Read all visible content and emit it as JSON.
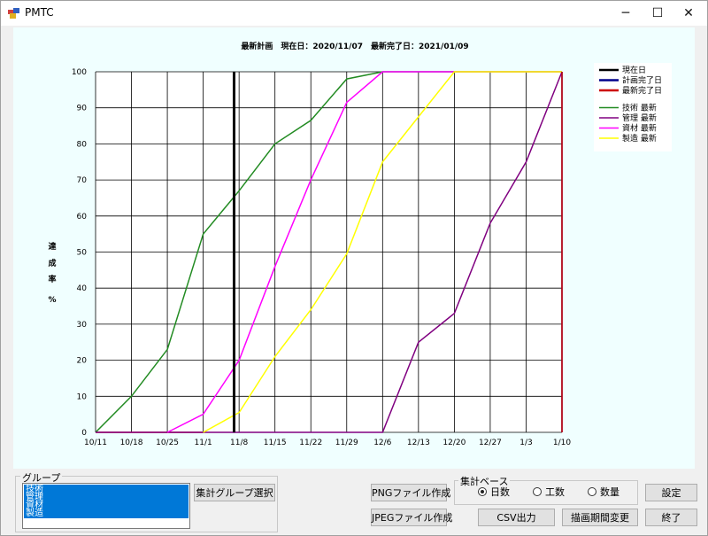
{
  "window": {
    "title": "PMTC",
    "controls": [
      "─",
      "☐",
      "✕"
    ]
  },
  "chart_data": {
    "type": "line",
    "title": "最新計画　現在日：2020/11/07　最新完了日：2021/01/09",
    "ylabel": "達成率 %",
    "xlabel": "",
    "ylim": [
      0,
      100
    ],
    "yticks": [
      0,
      10,
      20,
      30,
      40,
      50,
      60,
      70,
      80,
      90,
      100
    ],
    "categories": [
      "10/11",
      "10/18",
      "10/25",
      "11/1",
      "11/8",
      "11/15",
      "11/22",
      "11/29",
      "12/6",
      "12/13",
      "12/20",
      "12/27",
      "1/3",
      "1/10"
    ],
    "grid": true,
    "legend_position": "top-right",
    "markers": [
      {
        "name": "現在日",
        "x": 3.86,
        "color": "#000000"
      },
      {
        "name": "計画完了日",
        "x": 13,
        "color": "#00008b"
      },
      {
        "name": "最新完了日",
        "x": 13,
        "color": "#cc0000"
      }
    ],
    "series": [
      {
        "name": "技術 最新",
        "color": "#228b22",
        "points": [
          [
            0,
            0
          ],
          [
            1,
            10
          ],
          [
            2,
            23
          ],
          [
            3,
            55
          ],
          [
            4,
            67
          ],
          [
            5,
            80
          ],
          [
            6,
            86.5
          ],
          [
            7,
            98
          ],
          [
            8,
            100
          ],
          [
            13,
            100
          ]
        ]
      },
      {
        "name": "管理 最新",
        "color": "#800080",
        "points": [
          [
            0,
            0
          ],
          [
            8,
            0
          ],
          [
            9,
            25
          ],
          [
            10,
            33
          ],
          [
            11,
            58
          ],
          [
            12,
            75
          ],
          [
            13,
            100
          ]
        ]
      },
      {
        "name": "資材 最新",
        "color": "#ff00ff",
        "points": [
          [
            2,
            0
          ],
          [
            3,
            5
          ],
          [
            4,
            20
          ],
          [
            5,
            46
          ],
          [
            6,
            70
          ],
          [
            7,
            91.5
          ],
          [
            8,
            100
          ],
          [
            13,
            100
          ]
        ]
      },
      {
        "name": "製造 最新",
        "color": "#ffff00",
        "points": [
          [
            3,
            0
          ],
          [
            4,
            5.5
          ],
          [
            5,
            21
          ],
          [
            6,
            34
          ],
          [
            7,
            49.5
          ],
          [
            8,
            75
          ],
          [
            9,
            87.5
          ],
          [
            10,
            100
          ],
          [
            13,
            100
          ]
        ]
      }
    ],
    "baseline": {
      "color": "#cc0000",
      "from": 0,
      "to": 3
    }
  },
  "group": {
    "label": "グループ",
    "items": [
      "技術",
      "管理",
      "資材",
      "製造"
    ],
    "select_button": "集計グループ選択"
  },
  "buttons": {
    "png": "PNGファイル作成",
    "jpeg": "JPEGファイル作成",
    "csv": "CSV出力",
    "period": "描画期間変更",
    "settings": "設定",
    "exit": "終了"
  },
  "base": {
    "label": "集計ベース",
    "options": [
      {
        "label": "日数",
        "selected": true
      },
      {
        "label": "工数",
        "selected": false
      },
      {
        "label": "数量",
        "selected": false
      }
    ]
  }
}
